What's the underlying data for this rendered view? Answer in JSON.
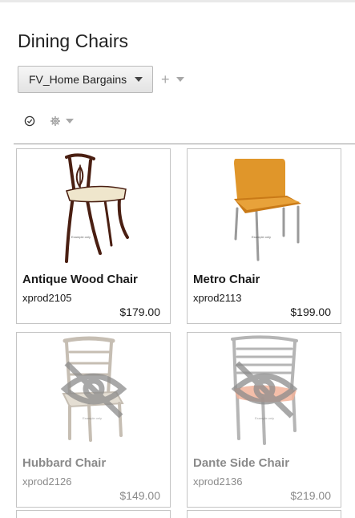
{
  "page": {
    "title": "Dining Chairs"
  },
  "toolbar": {
    "filter_label": "FV_Home Bargains",
    "add_symbol": "+"
  },
  "icons": {
    "filter_dropdown": "triangle-down-icon",
    "add": "plus-icon",
    "add_dropdown": "triangle-down-icon",
    "select_all": "check-circle-icon",
    "settings": "gear-icon",
    "settings_dropdown": "triangle-down-icon",
    "unavailable_overlay": "eye-slash-icon"
  },
  "products": [
    {
      "name": "Antique Wood Chair",
      "sku": "xprod2105",
      "price": "$179.00",
      "watermark": "Example only",
      "available": true
    },
    {
      "name": "Metro Chair",
      "sku": "xprod2113",
      "price": "$199.00",
      "watermark": "Example only",
      "available": true
    },
    {
      "name": "Hubbard Chair",
      "sku": "xprod2126",
      "price": "$149.00",
      "watermark": "Example only",
      "available": false
    },
    {
      "name": "Dante Side Chair",
      "sku": "xprod2136",
      "price": "$219.00",
      "watermark": "Example only",
      "available": false
    }
  ],
  "colors": {
    "inactive_text": "#8a8a8a",
    "metro_seat": "#e0962a",
    "antique_wood": "#4a1f12",
    "antique_cushion": "#efe6cc",
    "dante_cushion": "#f2b39a"
  }
}
